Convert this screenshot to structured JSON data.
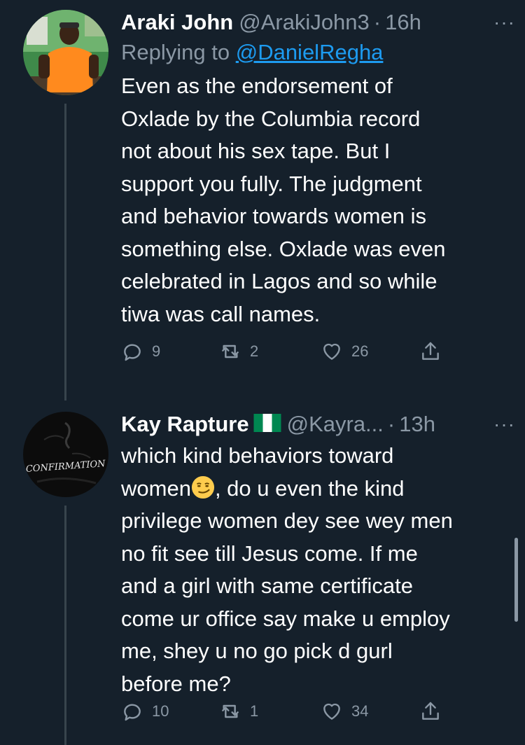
{
  "tweets": [
    {
      "name": "Araki John",
      "handle": "@ArakiJohn3",
      "separator": "·",
      "time": "16h",
      "more": "···",
      "replying_prefix": "Replying to",
      "replying_handle": "@DanielRegha",
      "text": "Even as the endorsement of\nOxlade by the Columbia record\nnot about his sex tape. But I\nsupport you fully. The judgment\nand behavior towards women is\nsomething else. Oxlade was even\ncelebrated in Lagos and so while\ntiwa was call names.",
      "replies": "9",
      "retweets": "2",
      "likes": "26",
      "avatar_icon": "person-photo-icon"
    },
    {
      "name": "Kay Rapture",
      "flag_icon": "nigeria-flag-icon",
      "handle": "@Kayra...",
      "separator": "·",
      "time": "13h",
      "more": "···",
      "text_before_emoji": "which kind behaviors toward\nwomen",
      "emoji_icon": "smirking-face-emoji",
      "text_after_emoji": ", do u even the kind\nprivilege women dey see wey men\nno fit see till Jesus come. If me\nand a girl with same certificate\ncome ur office say make u employ\nme, shey u no go pick d gurl\nbefore me?",
      "avatar_text": "CONFIRMATION",
      "replies": "10",
      "retweets": "1",
      "likes": "34",
      "avatar_icon": "confirmation-logo-icon"
    }
  ],
  "colors": {
    "background": "#15202b",
    "secondary_text": "#8b98a5",
    "link": "#1d9bf0",
    "thread_line": "#38444d"
  }
}
